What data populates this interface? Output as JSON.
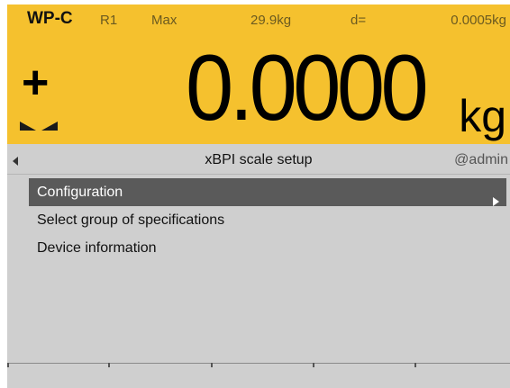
{
  "header": {
    "model": "WP-C",
    "range": "R1",
    "max_label": "Max",
    "max_value": "29.9kg",
    "d_label": "d=",
    "d_value": "0.0005kg",
    "sign": "+",
    "weight": "0.0000",
    "unit": "kg"
  },
  "titlebar": {
    "title": "xBPI scale setup",
    "user": "@admin",
    "back_icon": "triangle-left-icon"
  },
  "menu": {
    "items": [
      {
        "label": "Configuration",
        "selected": true,
        "has_submenu": true
      },
      {
        "label": "Select group of specifications",
        "selected": false
      },
      {
        "label": "Device information",
        "selected": false
      }
    ]
  },
  "softkeys": {
    "count": 5
  },
  "colors": {
    "header_bg": "#f5c12e",
    "panel_bg": "#cfcfcf",
    "selection_bg": "#5a5a5a"
  }
}
